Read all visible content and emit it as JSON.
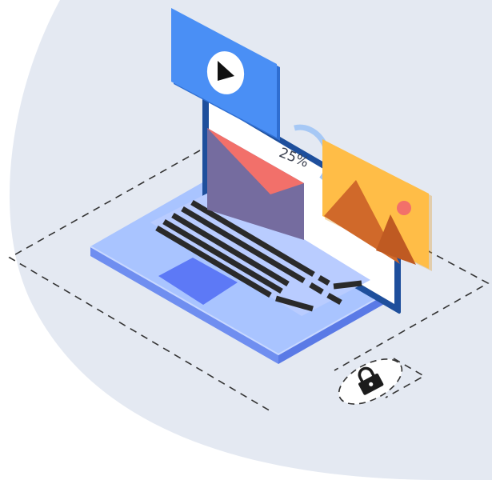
{
  "illustration": {
    "progress_label": "25%",
    "progress_fraction": 0.25,
    "icons": {
      "video": "play-icon",
      "mail": "envelope-icon",
      "image": "image-icon",
      "security": "lock-icon"
    },
    "colors": {
      "background_blob": "#e4e9f2",
      "laptop_body": "#a9c4ff",
      "laptop_edge": "#6f8ef0",
      "laptop_screen_frame": "#1e4f9c",
      "laptop_screen": "#ffffff",
      "touchpad": "#5d79f6",
      "keyboard_keys": "#2a2a2a",
      "video_card": "#4a8ff5",
      "envelope_body": "#756c9f",
      "envelope_flap": "#f2706a",
      "image_card": "#ffbd47",
      "mountains": "#d0692a",
      "sun": "#f2706a",
      "progress_arc": "#a6c8f5",
      "dashed_lines": "#333333",
      "lock": "#1c1c1c"
    }
  }
}
